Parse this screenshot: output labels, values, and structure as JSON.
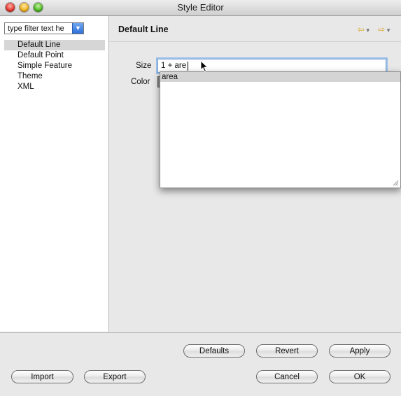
{
  "window": {
    "title": "Style Editor"
  },
  "sidebar": {
    "filter_text": "type filter text he",
    "items": [
      {
        "label": "Default Line",
        "selected": true
      },
      {
        "label": "Default Point"
      },
      {
        "label": "Simple Feature"
      },
      {
        "label": "Theme"
      },
      {
        "label": "XML"
      }
    ]
  },
  "page": {
    "title": "Default Line",
    "size_label": "Size",
    "color_label": "Color",
    "size_value": "1 + are",
    "autocomplete": [
      "area"
    ]
  },
  "buttons": {
    "defaults": "Defaults",
    "revert": "Revert",
    "apply": "Apply",
    "import": "Import",
    "export": "Export",
    "cancel": "Cancel",
    "ok": "OK"
  },
  "colors": {
    "nav_arrow": "#d9a521",
    "selection": "#d4d4d4",
    "focus_ring": "#9cc0ec"
  }
}
